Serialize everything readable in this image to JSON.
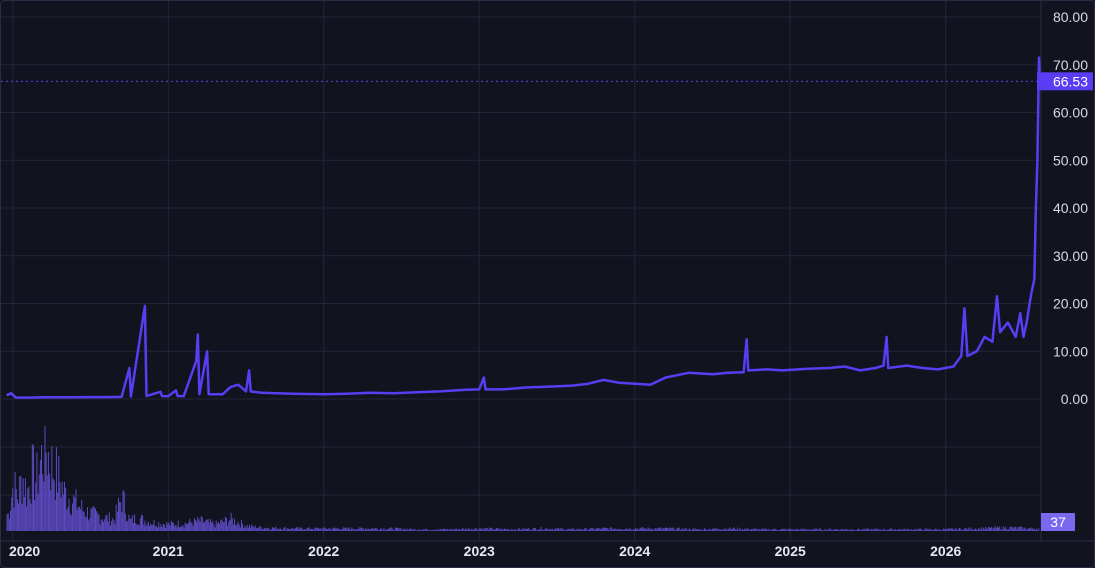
{
  "chart_data": {
    "type": "line",
    "y_ticks": [
      "80.00",
      "70.00",
      "60.00",
      "50.00",
      "40.00",
      "30.00",
      "20.00",
      "10.00",
      "0.00"
    ],
    "x_ticks": [
      "2020",
      "2021",
      "2022",
      "2023",
      "2024",
      "2025",
      "2026"
    ],
    "ylim": [
      0,
      80
    ],
    "xlim": [
      2019.95,
      2026.6
    ],
    "grid": true,
    "last_price": "66.53",
    "last_volume": "37",
    "colors": {
      "line": "#5a3cf2",
      "price_badge": "#5a3cf2",
      "volume_bar": "#6b55e0",
      "volume_badge": "#7c68f0",
      "grid": "#22253a",
      "background": "#11131f",
      "price_line": "#5a3cf2"
    },
    "series": [
      {
        "values": [
          [
            2019.96,
            0.8
          ],
          [
            2019.99,
            1.2
          ],
          [
            2020.02,
            0.3
          ],
          [
            2020.1,
            0.3
          ],
          [
            2020.2,
            0.35
          ],
          [
            2020.3,
            0.35
          ],
          [
            2020.4,
            0.35
          ],
          [
            2020.5,
            0.4
          ],
          [
            2020.6,
            0.4
          ],
          [
            2020.7,
            0.45
          ],
          [
            2020.75,
            6.5
          ],
          [
            2020.76,
            0.5
          ],
          [
            2020.85,
            19.5
          ],
          [
            2020.86,
            0.6
          ],
          [
            2020.95,
            1.5
          ],
          [
            2020.96,
            0.6
          ],
          [
            2021.0,
            0.6
          ],
          [
            2021.05,
            1.8
          ],
          [
            2021.06,
            0.6
          ],
          [
            2021.1,
            0.6
          ],
          [
            2021.18,
            8.0
          ],
          [
            2021.19,
            13.5
          ],
          [
            2021.2,
            1.0
          ],
          [
            2021.25,
            10.0
          ],
          [
            2021.26,
            1.0
          ],
          [
            2021.35,
            1.0
          ],
          [
            2021.4,
            2.5
          ],
          [
            2021.45,
            3.0
          ],
          [
            2021.5,
            1.6
          ],
          [
            2021.52,
            6.0
          ],
          [
            2021.53,
            1.6
          ],
          [
            2021.6,
            1.3
          ],
          [
            2021.8,
            1.1
          ],
          [
            2022.0,
            1.0
          ],
          [
            2022.15,
            1.1
          ],
          [
            2022.3,
            1.3
          ],
          [
            2022.45,
            1.2
          ],
          [
            2022.6,
            1.4
          ],
          [
            2022.75,
            1.6
          ],
          [
            2022.9,
            1.9
          ],
          [
            2023.0,
            2.0
          ],
          [
            2023.03,
            4.5
          ],
          [
            2023.04,
            2.0
          ],
          [
            2023.15,
            2.0
          ],
          [
            2023.3,
            2.4
          ],
          [
            2023.45,
            2.6
          ],
          [
            2023.6,
            2.8
          ],
          [
            2023.7,
            3.2
          ],
          [
            2023.8,
            4.0
          ],
          [
            2023.9,
            3.4
          ],
          [
            2024.0,
            3.2
          ],
          [
            2024.1,
            3.0
          ],
          [
            2024.2,
            4.5
          ],
          [
            2024.35,
            5.5
          ],
          [
            2024.5,
            5.2
          ],
          [
            2024.6,
            5.5
          ],
          [
            2024.7,
            5.6
          ],
          [
            2024.72,
            12.5
          ],
          [
            2024.73,
            6.0
          ],
          [
            2024.85,
            6.2
          ],
          [
            2024.95,
            6.0
          ],
          [
            2025.1,
            6.3
          ],
          [
            2025.25,
            6.5
          ],
          [
            2025.35,
            6.8
          ],
          [
            2025.45,
            6.0
          ],
          [
            2025.55,
            6.5
          ],
          [
            2025.6,
            7.0
          ],
          [
            2025.62,
            13.0
          ],
          [
            2025.63,
            6.5
          ],
          [
            2025.75,
            7.0
          ],
          [
            2025.85,
            6.5
          ],
          [
            2025.95,
            6.2
          ],
          [
            2026.05,
            6.8
          ],
          [
            2026.1,
            9.0
          ],
          [
            2026.12,
            19.0
          ],
          [
            2026.14,
            9.0
          ],
          [
            2026.2,
            10.0
          ],
          [
            2026.25,
            13.0
          ],
          [
            2026.3,
            12.0
          ],
          [
            2026.33,
            21.5
          ],
          [
            2026.35,
            14.0
          ],
          [
            2026.4,
            16.0
          ],
          [
            2026.45,
            13.0
          ],
          [
            2026.48,
            18.0
          ],
          [
            2026.5,
            13.0
          ],
          [
            2026.52,
            16.0
          ],
          [
            2026.55,
            22.0
          ],
          [
            2026.57,
            25.0
          ],
          [
            2026.58,
            40.0
          ],
          [
            2026.59,
            50.0
          ],
          [
            2026.6,
            71.5
          ],
          [
            2026.605,
            66.53
          ]
        ]
      }
    ],
    "volume": {
      "ylim": [
        0,
        100
      ],
      "values": [
        [
          2019.97,
          20
        ],
        [
          2020.0,
          55
        ],
        [
          2020.03,
          40
        ],
        [
          2020.06,
          65
        ],
        [
          2020.09,
          45
        ],
        [
          2020.12,
          70
        ],
        [
          2020.15,
          60
        ],
        [
          2020.18,
          85
        ],
        [
          2020.21,
          100
        ],
        [
          2020.24,
          80
        ],
        [
          2020.27,
          70
        ],
        [
          2020.3,
          60
        ],
        [
          2020.33,
          45
        ],
        [
          2020.36,
          40
        ],
        [
          2020.39,
          35
        ],
        [
          2020.42,
          30
        ],
        [
          2020.45,
          25
        ],
        [
          2020.5,
          20
        ],
        [
          2020.55,
          18
        ],
        [
          2020.6,
          15
        ],
        [
          2020.65,
          14
        ],
        [
          2020.7,
          40
        ],
        [
          2020.75,
          12
        ],
        [
          2020.8,
          16
        ],
        [
          2020.85,
          12
        ],
        [
          2020.9,
          10
        ],
        [
          2021.0,
          8
        ],
        [
          2021.1,
          9
        ],
        [
          2021.2,
          12
        ],
        [
          2021.3,
          8
        ],
        [
          2021.4,
          14
        ],
        [
          2021.5,
          6
        ],
        [
          2021.6,
          4
        ],
        [
          2021.8,
          3
        ],
        [
          2022.0,
          3
        ],
        [
          2022.2,
          3
        ],
        [
          2022.4,
          3
        ],
        [
          2022.6,
          2
        ],
        [
          2022.8,
          2
        ],
        [
          2023.0,
          3
        ],
        [
          2023.2,
          2
        ],
        [
          2023.4,
          3
        ],
        [
          2023.6,
          2
        ],
        [
          2023.8,
          3
        ],
        [
          2024.0,
          3
        ],
        [
          2024.2,
          3
        ],
        [
          2024.4,
          2
        ],
        [
          2024.6,
          3
        ],
        [
          2024.8,
          2
        ],
        [
          2025.0,
          2
        ],
        [
          2025.2,
          2
        ],
        [
          2025.4,
          2
        ],
        [
          2025.6,
          2
        ],
        [
          2025.8,
          2
        ],
        [
          2026.0,
          2
        ],
        [
          2026.2,
          3
        ],
        [
          2026.4,
          4
        ],
        [
          2026.55,
          3
        ]
      ]
    }
  }
}
